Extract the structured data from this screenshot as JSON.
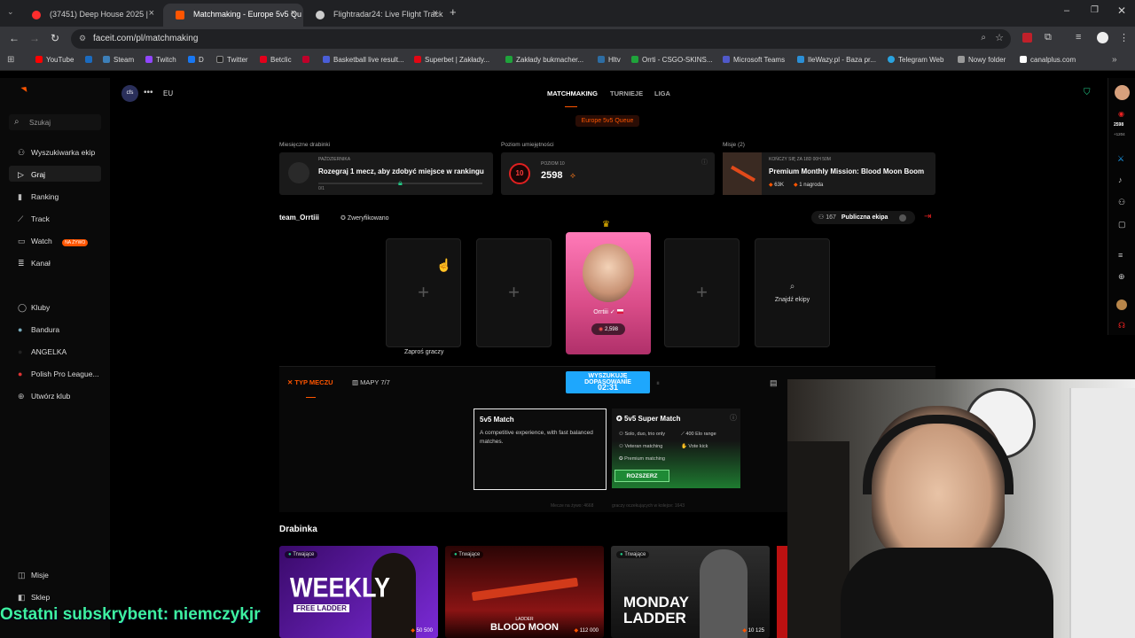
{
  "browser": {
    "tabs": [
      {
        "title": "(37451) Deep House 2025 |",
        "color": "#ff2d2d"
      },
      {
        "title": "Matchmaking - Europe 5v5 Qu",
        "color": "#ff5500"
      },
      {
        "title": "Flightradar24: Live Flight Track",
        "color": "#e0e0e0"
      }
    ],
    "url": "faceit.com/pl/matchmaking",
    "bookmarks": [
      "YouTube",
      "Steam",
      "Twitch",
      "D",
      "Twitter",
      "Betclic",
      "Basketball live result...",
      "Superbet | Zakłady...",
      "Zakłady bukmacher...",
      "Hltv",
      "Orrti - CSGO-SKINS...",
      "Microsoft Teams",
      "IleWazy.pl - Baza pr...",
      "Telegram Web",
      "Nowy folder",
      "canalplus.com"
    ]
  },
  "sidebar": {
    "search": "Szukaj",
    "items": [
      "Wyszukiwarka ekip",
      "Graj",
      "Ranking",
      "Track",
      "Watch",
      "Kanał"
    ],
    "live_badge": "NA ŻYWO",
    "clubs": [
      "Kluby",
      "Bandura",
      "ANGELKA",
      "Polish Pro League...",
      "Utwórz klub"
    ],
    "bottom": [
      "Misje",
      "Sklep"
    ]
  },
  "topnav": {
    "region": "EU",
    "links": [
      "MATCHMAKING",
      "TURNIEJE",
      "LIGA"
    ],
    "queue": "Europe 5v5 Queue"
  },
  "cards": {
    "monthly_label": "Miesięczne drabinki",
    "monthly_small": "PAŹDZIERNIKA",
    "monthly_text": "Rozegraj 1 mecz, aby zdobyć miejsce w rankingu",
    "monthly_progress": "0/1",
    "skill_label": "Poziom umiejętności",
    "skill_small": "POZIOM 10",
    "skill_level": "10",
    "skill_elo": "2598",
    "missions_label": "Misje (2)",
    "missions_small": "KOŃCZY SIĘ ZA 18D 00H 50M",
    "missions_title": "Premium Monthly Mission: Blood Moon Boom",
    "missions_points": "63K",
    "missions_reward": "1 nagroda"
  },
  "party": {
    "name": "team_Orrtiii",
    "verified": "Zweryfikowano",
    "public_count": "167",
    "public_label": "Publiczna ekipa",
    "invite_label": "Zaproś graczy",
    "player_name": "Orrtiii",
    "player_elo": "2,598",
    "find_label": "Znajdź ekipy"
  },
  "match": {
    "type_tab": "TYP MECZU",
    "maps_tab": "MAPY 7/7",
    "searching": "WYSZUKUJĘ DOPASOWANIE",
    "timer": "02:31",
    "option1_title": "5v5 Match",
    "option1_desc": "A competitive experience, with fast balanced matches.",
    "option2_title": "5v5 Super Match",
    "option2_features": [
      "Solo, duo, trio only",
      "400 Elo range",
      "Veteran matching",
      "Vote kick",
      "Premium matching"
    ],
    "expand_button": "ROZSZERZ",
    "stats_line_a": "Mecze na żywo: 4668",
    "stats_line_b": "graczy oczekujących w kolejce: 1643"
  },
  "ladders": {
    "heading": "Drabinka",
    "status": "Trwające",
    "items": [
      {
        "title": "WEEKLY",
        "sub": "FREE LADDER",
        "prize": "50 500"
      },
      {
        "title": "LADDER",
        "sub": "BLOOD MOON",
        "prize": "112 000"
      },
      {
        "title": "MONDAY",
        "sub": "LADDER",
        "prize": "10 125"
      }
    ]
  },
  "overlay": {
    "subscriber": "Ostatni subskrybent: niemczykjr"
  },
  "right_rail": {
    "elo_value": "2598",
    "elo_delta": "+1204"
  }
}
